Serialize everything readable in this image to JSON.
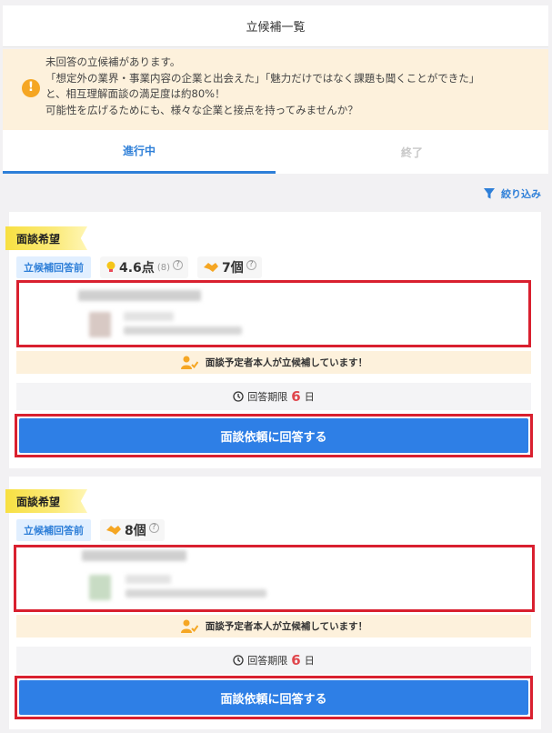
{
  "header": {
    "title": "立候補一覧"
  },
  "notice": {
    "icon": "exclamation-icon",
    "lines": [
      "未回答の立候補があります。",
      "「想定外の業界・事業内容の企業と出会えた」「魅力だけではなく課題も聞くことができた」",
      "と、相互理解面談の満足度は約80%！",
      "可能性を広げるためにも、様々な企業と接点を持ってみませんか？"
    ]
  },
  "tabs": [
    {
      "label": "進行中",
      "active": true
    },
    {
      "label": "終了",
      "active": false
    }
  ],
  "filter": {
    "label": "絞り込み",
    "icon": "funnel-icon"
  },
  "cards": [
    {
      "ribbon": "面談希望",
      "badge": "立候補回答前",
      "rating": {
        "value": "4.6点",
        "count": "(8)"
      },
      "hands": "7個",
      "strip": "面談予定者本人が立候補しています！",
      "deadline": {
        "prefix": "回答期限",
        "days": "6",
        "suffix": "日"
      },
      "button": "面談依頼に回答する"
    },
    {
      "ribbon": "面談希望",
      "badge": "立候補回答前",
      "hands": "8個",
      "strip": "面談予定者本人が立候補しています！",
      "deadline": {
        "prefix": "回答期限",
        "days": "6",
        "suffix": "日"
      },
      "button": "面談依頼に回答する"
    }
  ],
  "colors": {
    "accent": "#2e7fd8",
    "highlight": "#d9202f",
    "notice_bg": "#fdf1dc"
  }
}
